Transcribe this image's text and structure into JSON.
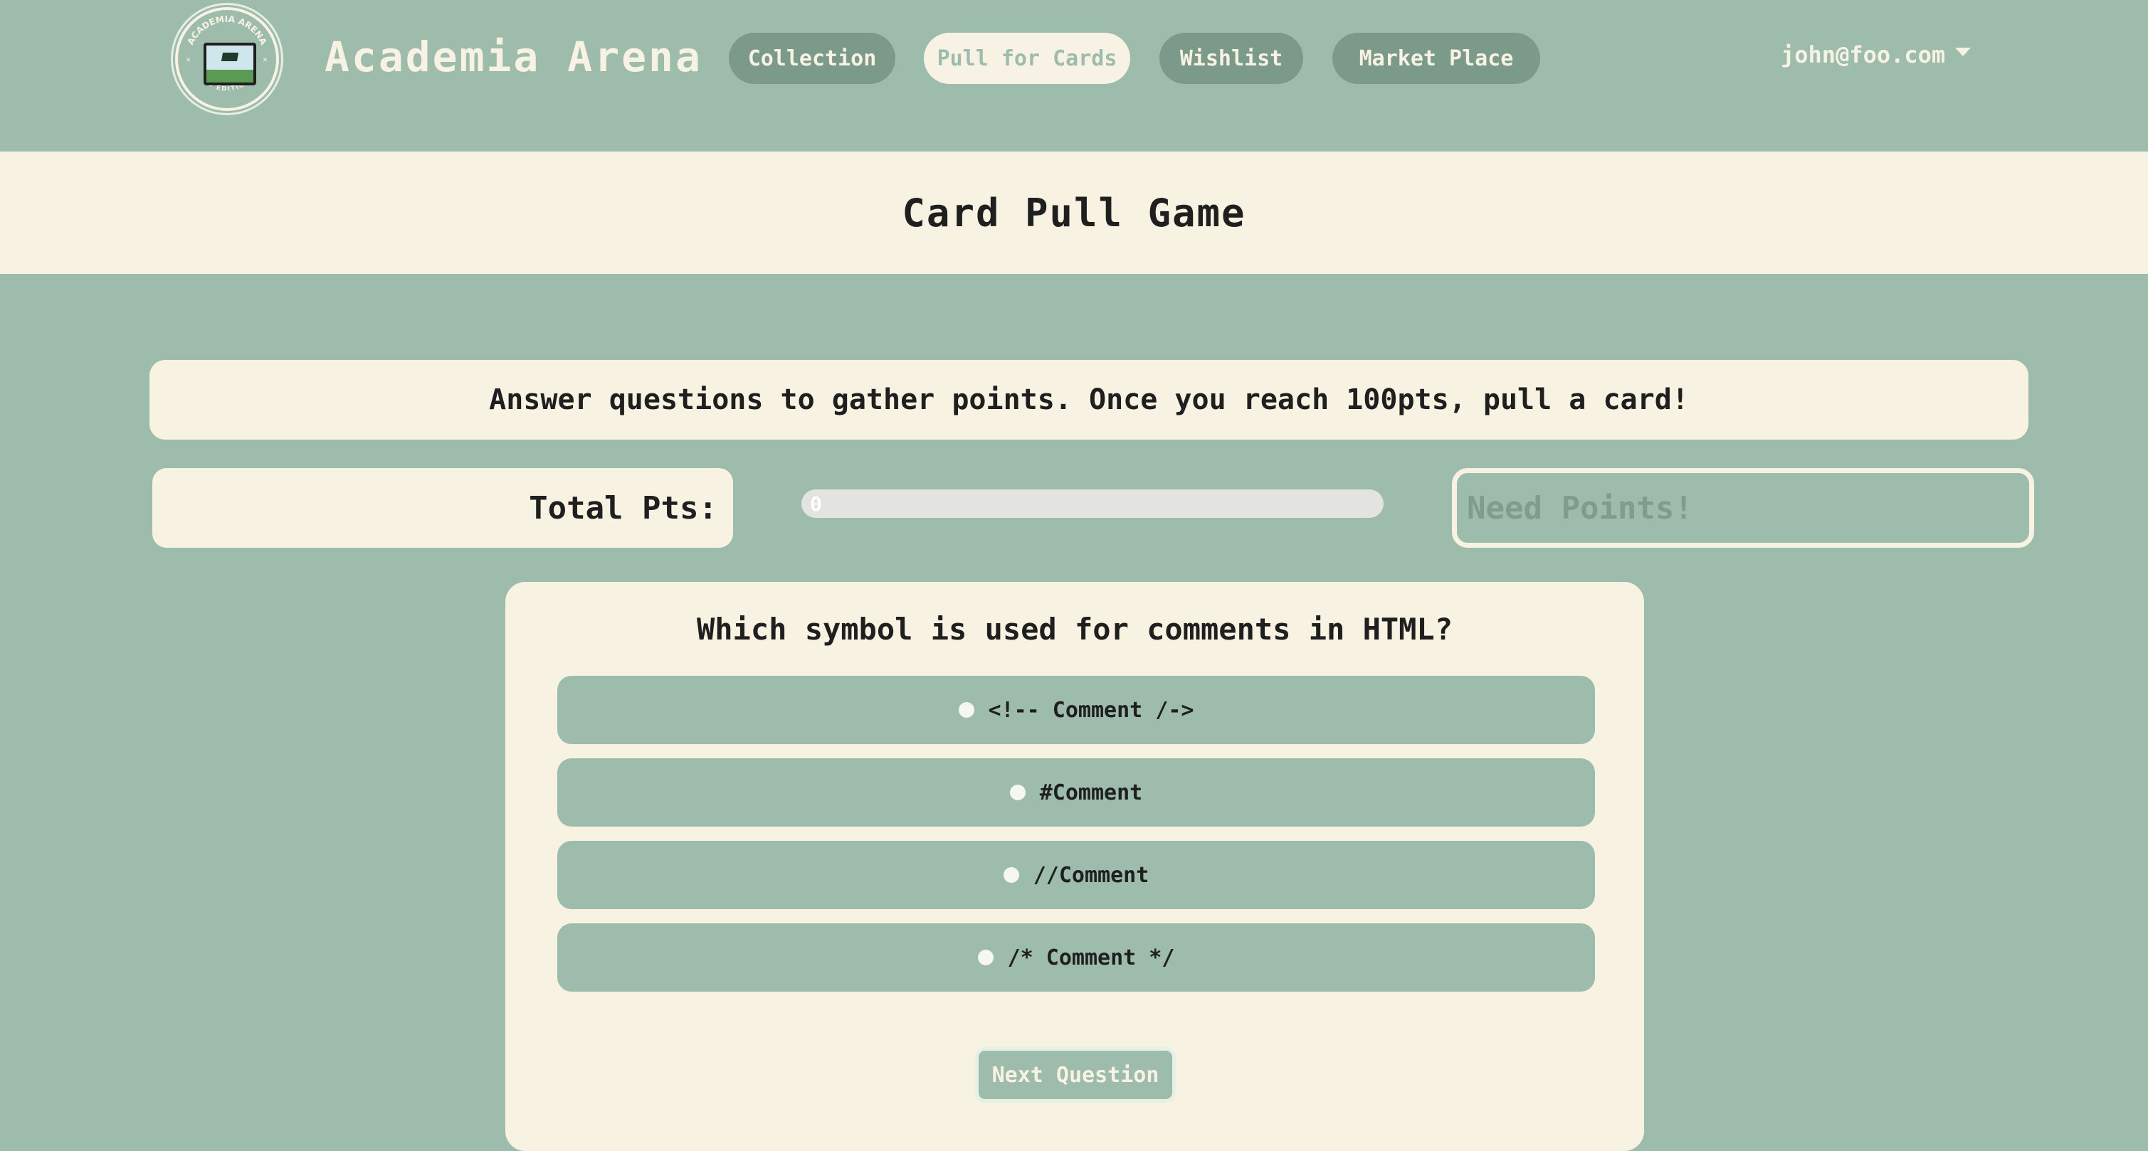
{
  "app": {
    "brand": "Academia Arena",
    "logo_text_top": "ACADEMIA ARENA",
    "logo_text_bottom": "CS EDITION"
  },
  "nav": {
    "items": [
      {
        "label": "Collection",
        "active": false
      },
      {
        "label": "Pull for Cards",
        "active": true
      },
      {
        "label": "Wishlist",
        "active": false
      },
      {
        "label": "Market Place",
        "active": false
      }
    ],
    "user": "john@foo.com"
  },
  "page": {
    "title": "Card Pull Game",
    "instructions": "Answer questions to gather points. Once you reach 100pts, pull a card!"
  },
  "points": {
    "label": "Total Pts:",
    "value": "0",
    "progress_fraction": 0,
    "pull_placeholder": "Need Points!"
  },
  "quiz": {
    "question": "Which symbol is used for comments in HTML?",
    "options": [
      "<!-- Comment /->",
      "#Comment",
      "//Comment",
      "/* Comment */"
    ],
    "next_label": "Next Question"
  },
  "colors": {
    "background": "#9ebcab",
    "cream": "#f8f2e3",
    "button_dark": "#7b9a89",
    "text": "#1f1f1f"
  }
}
